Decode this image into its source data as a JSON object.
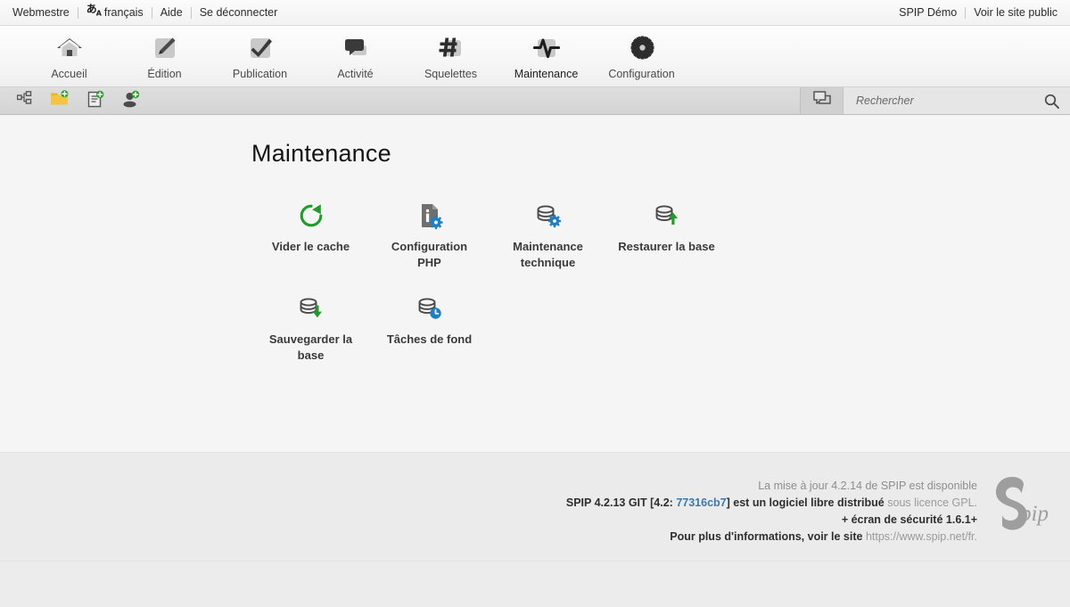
{
  "topbar": {
    "left": [
      {
        "label": "Webmestre",
        "name": "webmestre-link"
      },
      {
        "label": "français",
        "name": "language-link"
      },
      {
        "label": "Aide",
        "name": "help-link"
      },
      {
        "label": "Se déconnecter",
        "name": "logout-link"
      }
    ],
    "language_glyph": "あ",
    "language_glyph_sub": "A",
    "right": [
      {
        "label": "SPIP Démo",
        "name": "site-name-link"
      },
      {
        "label": "Voir le site public",
        "name": "view-public-site-link"
      }
    ]
  },
  "mainnav": {
    "items": [
      {
        "label": "Accueil",
        "icon": "home-icon",
        "active": false
      },
      {
        "label": "Édition",
        "icon": "pencil-icon",
        "active": false
      },
      {
        "label": "Publication",
        "icon": "check-icon",
        "active": false
      },
      {
        "label": "Activité",
        "icon": "speech-bubble-icon",
        "active": false
      },
      {
        "label": "Squelettes",
        "icon": "hash-icon",
        "active": false
      },
      {
        "label": "Maintenance",
        "icon": "pulse-icon",
        "active": true
      },
      {
        "label": "Configuration",
        "icon": "gear-icon",
        "active": false
      }
    ]
  },
  "subbar": {
    "buttons": [
      {
        "name": "site-tree-button",
        "icon": "sitemap-icon"
      },
      {
        "name": "new-folder-button",
        "icon": "folder-add-icon"
      },
      {
        "name": "new-article-button",
        "icon": "document-add-icon"
      },
      {
        "name": "new-author-button",
        "icon": "user-add-icon"
      }
    ],
    "messages_icon": "speech-bubble-icon",
    "search": {
      "placeholder": "Rechercher",
      "value": "",
      "icon": "search-icon"
    }
  },
  "main": {
    "title": "Maintenance",
    "items": [
      {
        "label": "Vider le cache",
        "icon": "refresh-icon"
      },
      {
        "label": "Configuration PHP",
        "icon": "php-info-icon"
      },
      {
        "label": "Maintenance technique",
        "icon": "database-gear-icon"
      },
      {
        "label": "Restaurer la base",
        "icon": "database-up-icon"
      },
      {
        "label": "Sauvegarder la base",
        "icon": "database-down-icon"
      },
      {
        "label": "Tâches de fond",
        "icon": "database-clock-icon"
      }
    ]
  },
  "footer": {
    "update_notice": "La mise à jour 4.2.14 de SPIP est disponible",
    "version_bold": "SPIP 4.2.13 GIT [4.2:",
    "version_hash": "77316cb7",
    "version_tail": "] est un logiciel libre distribué",
    "license_label": "sous licence GPL.",
    "security_line": "+ écran de sécurité 1.6.1+",
    "more_info_label": "Pour plus d'informations, voir le site",
    "site_url": "https://www.spip.net/fr.",
    "logo_s": "S",
    "logo_pip": "pip"
  },
  "colors": {
    "green": "#1f9d2a",
    "blue": "#1f7fc4",
    "link_blue": "#3b78b0",
    "icon_gray": "#4a4a4a",
    "folder_yellow": "#f0b323"
  }
}
